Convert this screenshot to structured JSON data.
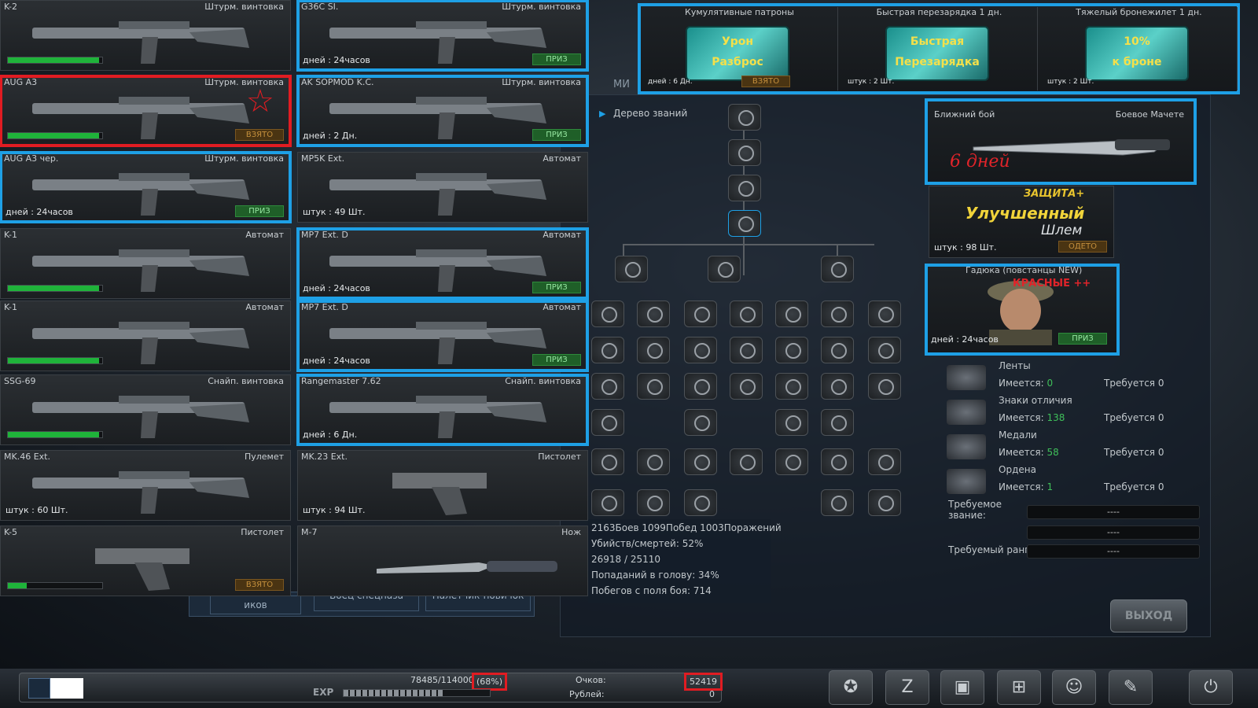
{
  "left_column": [
    {
      "name": "K-2",
      "category": "Штурм. винтовка",
      "info": "",
      "bar_fraction": 0.97,
      "tag": ""
    },
    {
      "name": "AUG A3",
      "category": "Штурм. винтовка",
      "info": "",
      "bar_fraction": 0.97,
      "tag": "ВЗЯТО"
    },
    {
      "name": "AUG A3 чер.",
      "category": "Штурм. винтовка",
      "info": "дней : 24часов",
      "bar_fraction": null,
      "tag": "ПРИЗ"
    },
    {
      "name": "K-1",
      "category": "Автомат",
      "info": "",
      "bar_fraction": 0.97,
      "tag": ""
    },
    {
      "name": "K-1",
      "category": "Автомат",
      "info": "",
      "bar_fraction": 0.97,
      "tag": ""
    },
    {
      "name": "SSG-69",
      "category": "Снайп. винтовка",
      "info": "",
      "bar_fraction": 0.97,
      "tag": ""
    },
    {
      "name": "MK.46 Ext.",
      "category": "Пулемет",
      "info": "штук : 60 Шт.",
      "bar_fraction": null,
      "tag": ""
    },
    {
      "name": "K-5",
      "category": "Пистолет",
      "info": "",
      "bar_fraction": 0.2,
      "tag": "ВЗЯТО"
    }
  ],
  "right_column": [
    {
      "name": "G36C SI.",
      "category": "Штурм. винтовка",
      "info": "дней : 24часов",
      "tag": "ПРИЗ"
    },
    {
      "name": "AK SOPMOD K.C.",
      "category": "Штурм. винтовка",
      "info": "дней : 2 Дн.",
      "tag": "ПРИЗ"
    },
    {
      "name": "MP5K Ext.",
      "category": "Автомат",
      "info": "штук : 49 Шт.",
      "tag": ""
    },
    {
      "name": "MP7 Ext. D",
      "category": "Автомат",
      "info": "дней : 24часов",
      "tag": "ПРИЗ"
    },
    {
      "name": "MP7 Ext. D",
      "category": "Автомат",
      "info": "дней : 24часов",
      "tag": "ПРИЗ"
    },
    {
      "name": "Rangemaster 7.62",
      "category": "Снайп. винтовка",
      "info": "дней : 6 Дн.",
      "tag": ""
    },
    {
      "name": "MK.23 Ext.",
      "category": "Пистолет",
      "info": "штук : 94 Шт.",
      "tag": ""
    },
    {
      "name": "M-7",
      "category": "Нож",
      "info": "",
      "tag": ""
    }
  ],
  "boosts": [
    {
      "title": "Кумулятивные патроны",
      "label_top": "Урон",
      "label_bottom": "Разброс",
      "info": "дней : 6 Дн.",
      "tag": "ВЗЯТО"
    },
    {
      "title": "Быстрая перезарядка 1 дн.",
      "label_top": "Быстрая",
      "label_bottom": "Перезарядка",
      "info": "штук : 2 Шт.",
      "tag": ""
    },
    {
      "title": "Тяжелый бронежилет 1 дн.",
      "label_top": "10%",
      "label_bottom": "к броне",
      "info": "штук : 2 Шт.",
      "tag": ""
    }
  ],
  "melee": {
    "category": "Ближний бой",
    "name": "Боевое Мачете",
    "days_note": "6 дней"
  },
  "helmet": {
    "line1": "ЗАЩИТА+",
    "line2": "Улучшенный",
    "line3": "Шлем",
    "info": "штук : 98 Шт.",
    "tag": "ОДЕТО"
  },
  "character": {
    "name": "Гадюка (повстанцы NEW)",
    "tag_text": "КРАСНЫЕ ++",
    "info": "дней : 24часов",
    "tag": "ПРИЗ"
  },
  "rank_tree_title": "Дерево званий",
  "stats": [
    "2163Боев 1099Побед 1003Поражений",
    "Убийств/смертей: 52%",
    "26918 / 25110",
    "Попаданий в голову: 34%",
    "Побегов с поля боя: 714"
  ],
  "requirements": [
    {
      "title": "Ленты",
      "have": "0",
      "need": "Требуется 0"
    },
    {
      "title": "Знаки отличия",
      "have": "138",
      "need": "Требуется 0"
    },
    {
      "title": "Медали",
      "have": "58",
      "need": "Требуется 0"
    },
    {
      "title": "Ордена",
      "have": "1",
      "need": "Требуется 0"
    }
  ],
  "have_label": "Имеется:",
  "required_rank_label": "Требуемое звание:",
  "required_level_label": "Требуемый ранг:",
  "dash": "----",
  "exit_label": "ВЫХОД",
  "bg_tabs": [
    "иков",
    "Боец спецназа",
    "Налетчик-новичок"
  ],
  "bg_mi": "МИ",
  "exp": {
    "text": "78485/114000",
    "pct": "(68%)",
    "label": "EXP",
    "fraction": 0.68
  },
  "points_label": "Очков:",
  "points_value": "52419",
  "rubles_label": "Рублей:",
  "rubles_value": "0",
  "toolbar_icons": [
    "emblem-icon",
    "z-icon",
    "briefcase-icon",
    "cart-icon",
    "people-icon",
    "wrench-icon",
    "power-icon"
  ]
}
